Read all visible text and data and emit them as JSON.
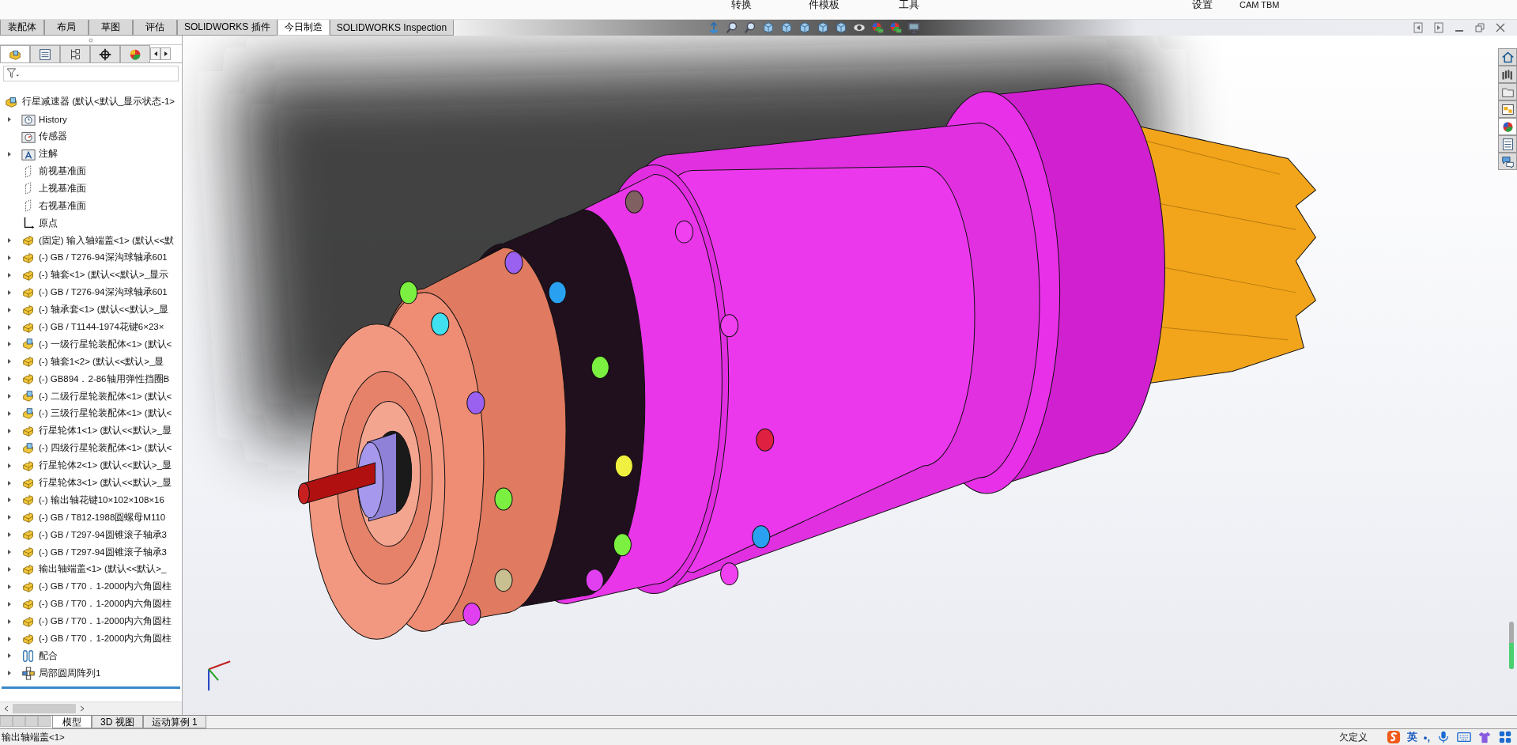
{
  "ribbon": {
    "labels": [
      "转换",
      "件模板",
      "工具",
      "设置",
      "CAM TBM"
    ]
  },
  "command_tabs": [
    {
      "label": "装配体",
      "selected": false
    },
    {
      "label": "布局",
      "selected": false
    },
    {
      "label": "草图",
      "selected": false
    },
    {
      "label": "评估",
      "selected": false
    },
    {
      "label": "SOLIDWORKS 插件",
      "selected": false
    },
    {
      "label": "今日制造",
      "selected": true
    },
    {
      "label": "SOLIDWORKS Inspection",
      "selected": false
    }
  ],
  "panel_tabs": [
    {
      "kind": "feature-tree",
      "selected": true
    },
    {
      "kind": "property",
      "selected": false
    },
    {
      "kind": "config",
      "selected": false
    },
    {
      "kind": "dimxpert",
      "selected": false
    },
    {
      "kind": "appearance",
      "selected": false
    }
  ],
  "tree": {
    "root": "行星减速器 (默认<默认_显示状态-1>",
    "items": [
      {
        "kind": "history",
        "label": "History",
        "expandable": true
      },
      {
        "kind": "sensor",
        "label": "传感器",
        "expandable": false
      },
      {
        "kind": "annotation",
        "label": "注解",
        "expandable": true
      },
      {
        "kind": "plane",
        "label": "前视基准面",
        "expandable": false
      },
      {
        "kind": "plane",
        "label": "上视基准面",
        "expandable": false
      },
      {
        "kind": "plane",
        "label": "右视基准面",
        "expandable": false
      },
      {
        "kind": "origin",
        "label": "原点",
        "expandable": false
      },
      {
        "kind": "part",
        "label": "(固定) 输入轴端盖<1> (默认<<默",
        "expandable": true
      },
      {
        "kind": "part",
        "label": "(-) GB / T276-94深沟球轴承601",
        "expandable": true
      },
      {
        "kind": "part",
        "label": "(-) 轴套<1> (默认<<默认>_显示",
        "expandable": true
      },
      {
        "kind": "part",
        "label": "(-) GB / T276-94深沟球轴承601",
        "expandable": true
      },
      {
        "kind": "part",
        "label": "(-) 轴承套<1> (默认<<默认>_显",
        "expandable": true
      },
      {
        "kind": "part",
        "label": "(-) GB / T1144-1974花键6×23×",
        "expandable": true
      },
      {
        "kind": "assembly",
        "label": "(-) 一级行星轮装配体<1> (默认<",
        "expandable": true
      },
      {
        "kind": "part",
        "label": "(-) 轴套1<2> (默认<<默认>_显",
        "expandable": true
      },
      {
        "kind": "part",
        "label": "(-) GB894．2-86轴用弹性挡圈B",
        "expandable": true
      },
      {
        "kind": "assembly",
        "label": "(-) 二级行星轮装配体<1> (默认<",
        "expandable": true
      },
      {
        "kind": "assembly",
        "label": "(-) 三级行星轮装配体<1> (默认<",
        "expandable": true
      },
      {
        "kind": "part",
        "label": "行星轮体1<1> (默认<<默认>_显",
        "expandable": true
      },
      {
        "kind": "assembly",
        "label": "(-) 四级行星轮装配体<1> (默认<",
        "expandable": true
      },
      {
        "kind": "part",
        "label": "行星轮体2<1> (默认<<默认>_显",
        "expandable": true
      },
      {
        "kind": "part",
        "label": "行星轮体3<1> (默认<<默认>_显",
        "expandable": true
      },
      {
        "kind": "part",
        "label": "(-) 输出轴花键10×102×108×16",
        "expandable": true
      },
      {
        "kind": "part",
        "label": "(-) GB / T812-1988圆螺母M110",
        "expandable": true
      },
      {
        "kind": "part",
        "label": "(-) GB / T297-94圆锥滚子轴承3",
        "expandable": true
      },
      {
        "kind": "part",
        "label": "(-) GB / T297-94圆锥滚子轴承3",
        "expandable": true
      },
      {
        "kind": "part",
        "label": "输出轴端盖<1> (默认<<默认>_",
        "expandable": true
      },
      {
        "kind": "part",
        "label": "(-) GB / T70．1-2000内六角圆柱",
        "expandable": true
      },
      {
        "kind": "part",
        "label": "(-) GB / T70．1-2000内六角圆柱",
        "expandable": true
      },
      {
        "kind": "part",
        "label": "(-) GB / T70．1-2000内六角圆柱",
        "expandable": true
      },
      {
        "kind": "part",
        "label": "(-) GB / T70．1-2000内六角圆柱",
        "expandable": true
      },
      {
        "kind": "mate",
        "label": "配合",
        "expandable": true
      },
      {
        "kind": "pattern",
        "label": "局部圆周阵列1",
        "expandable": true
      }
    ]
  },
  "view_tabs": [
    {
      "label": "模型",
      "selected": true
    },
    {
      "label": "3D 视图",
      "selected": false
    },
    {
      "label": "运动算例 1",
      "selected": false
    }
  ],
  "status_bar": {
    "selection": "输出轴端盖<1>",
    "state": "欠定义",
    "ime_language": "英",
    "ime_punctuation": "•,"
  },
  "task_pane": [
    {
      "kind": "home",
      "selected": false
    },
    {
      "kind": "library",
      "selected": false
    },
    {
      "kind": "folder",
      "selected": false
    },
    {
      "kind": "palette",
      "selected": false
    },
    {
      "kind": "appearance",
      "selected": true
    },
    {
      "kind": "properties",
      "selected": false
    },
    {
      "kind": "forum",
      "selected": false
    }
  ]
}
